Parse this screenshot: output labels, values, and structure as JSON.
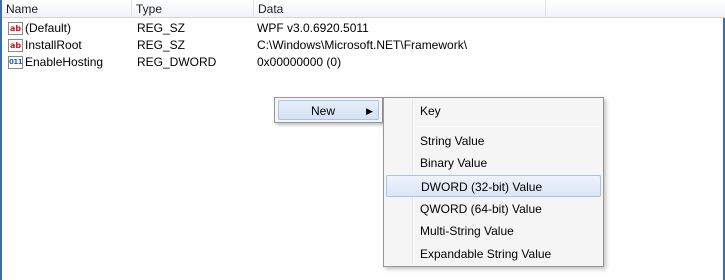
{
  "columns": {
    "name": "Name",
    "type": "Type",
    "data": "Data"
  },
  "rows": [
    {
      "icon": "string-value-icon",
      "icon_text": "ab",
      "name": "(Default)",
      "type": "REG_SZ",
      "data": "WPF v3.0.6920.5011"
    },
    {
      "icon": "string-value-icon",
      "icon_text": "ab",
      "name": "InstallRoot",
      "type": "REG_SZ",
      "data": "C:\\Windows\\Microsoft.NET\\Framework\\"
    },
    {
      "icon": "dword-value-icon",
      "icon_text": "011",
      "name": "EnableHosting",
      "type": "REG_DWORD",
      "data": "0x00000000 (0)"
    }
  ],
  "context_menu": {
    "new_label": "New",
    "arrow": "▶"
  },
  "submenu": {
    "items": [
      "Key",
      "String Value",
      "Binary Value",
      "DWORD (32-bit) Value",
      "QWORD (64-bit) Value",
      "Multi-String Value",
      "Expandable String Value"
    ],
    "highlighted": "DWORD (32-bit) Value"
  }
}
